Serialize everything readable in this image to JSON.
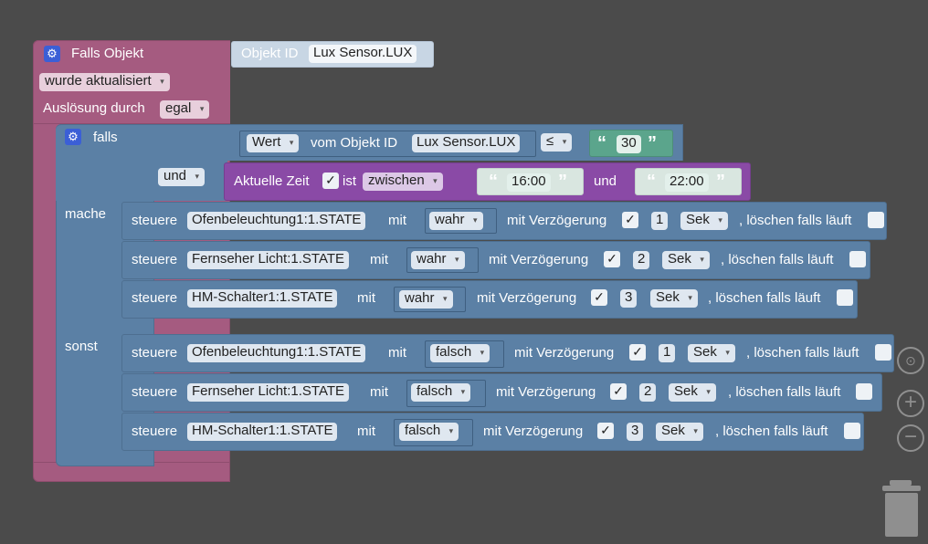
{
  "trigger": {
    "title": "Falls Objekt",
    "event": "wurde aktualisiert",
    "ack_label": "Auslösung durch",
    "ack_value": "egal",
    "objid_label": "Objekt ID",
    "objid_value": "Lux Sensor.LUX"
  },
  "if_block": {
    "falls": "falls",
    "mache": "mache",
    "sonst": "sonst",
    "cmp": {
      "prop": "Wert",
      "from_label": "vom Objekt ID",
      "obj": "Lux Sensor.LUX",
      "op": "≤",
      "value": "30"
    },
    "and_label": "und",
    "time": {
      "label": "Aktuelle Zeit",
      "ist": "ist",
      "mode": "zwischen",
      "start": "16:00",
      "and": "und",
      "end": "22:00"
    }
  },
  "control": {
    "steuere": "steuere",
    "mit": "mit",
    "delay_label": "mit Verzögerung",
    "clear_label": ", löschen falls läuft",
    "unit": "Sek",
    "check": "✓"
  },
  "then_rows": [
    {
      "object": "Ofenbeleuchtung1:1.STATE",
      "value": "wahr",
      "delay": "1"
    },
    {
      "object": "Fernseher Licht:1.STATE",
      "value": "wahr",
      "delay": "2"
    },
    {
      "object": "HM-Schalter1:1.STATE",
      "value": "wahr",
      "delay": "3"
    }
  ],
  "else_rows": [
    {
      "object": "Ofenbeleuchtung1:1.STATE",
      "value": "falsch",
      "delay": "1"
    },
    {
      "object": "Fernseher Licht:1.STATE",
      "value": "falsch",
      "delay": "2"
    },
    {
      "object": "HM-Schalter1:1.STATE",
      "value": "falsch",
      "delay": "3"
    }
  ],
  "icons": {
    "gear": "gear-icon",
    "caret": "▾",
    "target": "center-target-icon",
    "zoom_in": "zoom-in-icon",
    "zoom_out": "zoom-out-icon",
    "trash": "trash-icon"
  },
  "colors": {
    "workspace": "#4b4b4b",
    "event_block": "#a55b80",
    "logic_block": "#5b80a5",
    "time_block": "#8a4aa6",
    "text_block": "#5ba58c"
  }
}
